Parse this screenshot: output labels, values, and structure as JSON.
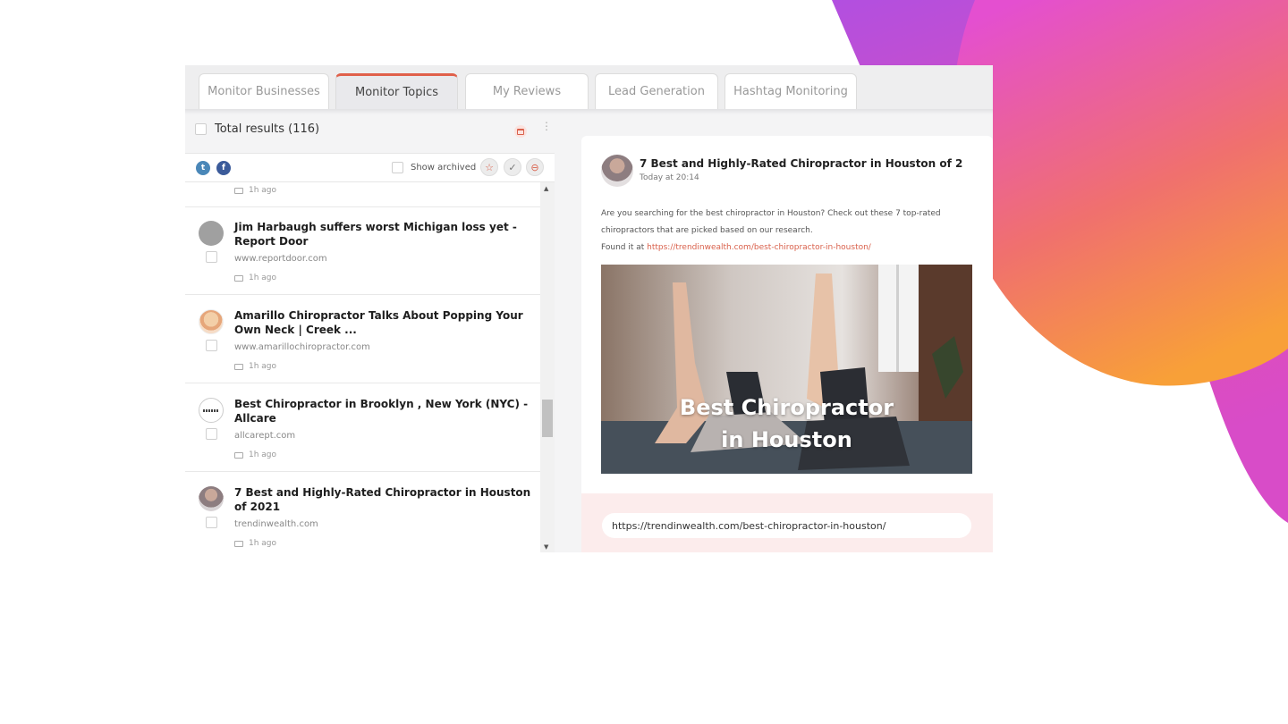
{
  "tabs": [
    {
      "label": "Monitor Businesses"
    },
    {
      "label": "Monitor Topics"
    },
    {
      "label": "My Reviews"
    },
    {
      "label": "Lead Generation"
    },
    {
      "label": "Hashtag Monitoring"
    }
  ],
  "active_tab": "Monitor Topics",
  "results": {
    "total_label": "Total results (116)"
  },
  "filters": {
    "show_archived": "Show archived",
    "social_icons": [
      "twitter-icon",
      "facebook-icon"
    ]
  },
  "list": {
    "top_partial_time": "1h ago",
    "items": [
      {
        "title": "Jim Harbaugh suffers worst Michigan loss yet - Report Door",
        "domain": "www.reportdoor.com",
        "time": "1h ago"
      },
      {
        "title": "Amarillo Chiropractor Talks About Popping Your Own Neck | Creek ...",
        "domain": "www.amarillochiropractor.com",
        "time": "1h ago"
      },
      {
        "title": "Best Chiropractor in Brooklyn , New York (NYC) - Allcare",
        "domain": "allcarept.com",
        "time": "1h ago"
      },
      {
        "title": "7 Best and Highly-Rated Chiropractor in Houston of 2021",
        "domain": "trendinwealth.com",
        "time": "1h ago"
      }
    ]
  },
  "preview": {
    "title": "7 Best and Highly-Rated Chiropractor in Houston of 2",
    "date": "Today at 20:14",
    "body_line1": "Are you searching for the best chiropractor in Houston? Check out these 7 top-rated",
    "body_line2": "chiropractors that are picked based on our research.",
    "found_label": "Found it at ",
    "found_url": "https://trendinwealth.com/best-chiropractor-in-houston/",
    "image_line1": "Best Chiropractor",
    "image_line2": "in Houston",
    "url_field": "https://trendinwealth.com/best-chiropractor-in-houston/"
  },
  "colors": {
    "accent": "#e0604a",
    "link": "#d9614c",
    "twitter": "#4a87b8",
    "facebook": "#3b5b9a"
  }
}
